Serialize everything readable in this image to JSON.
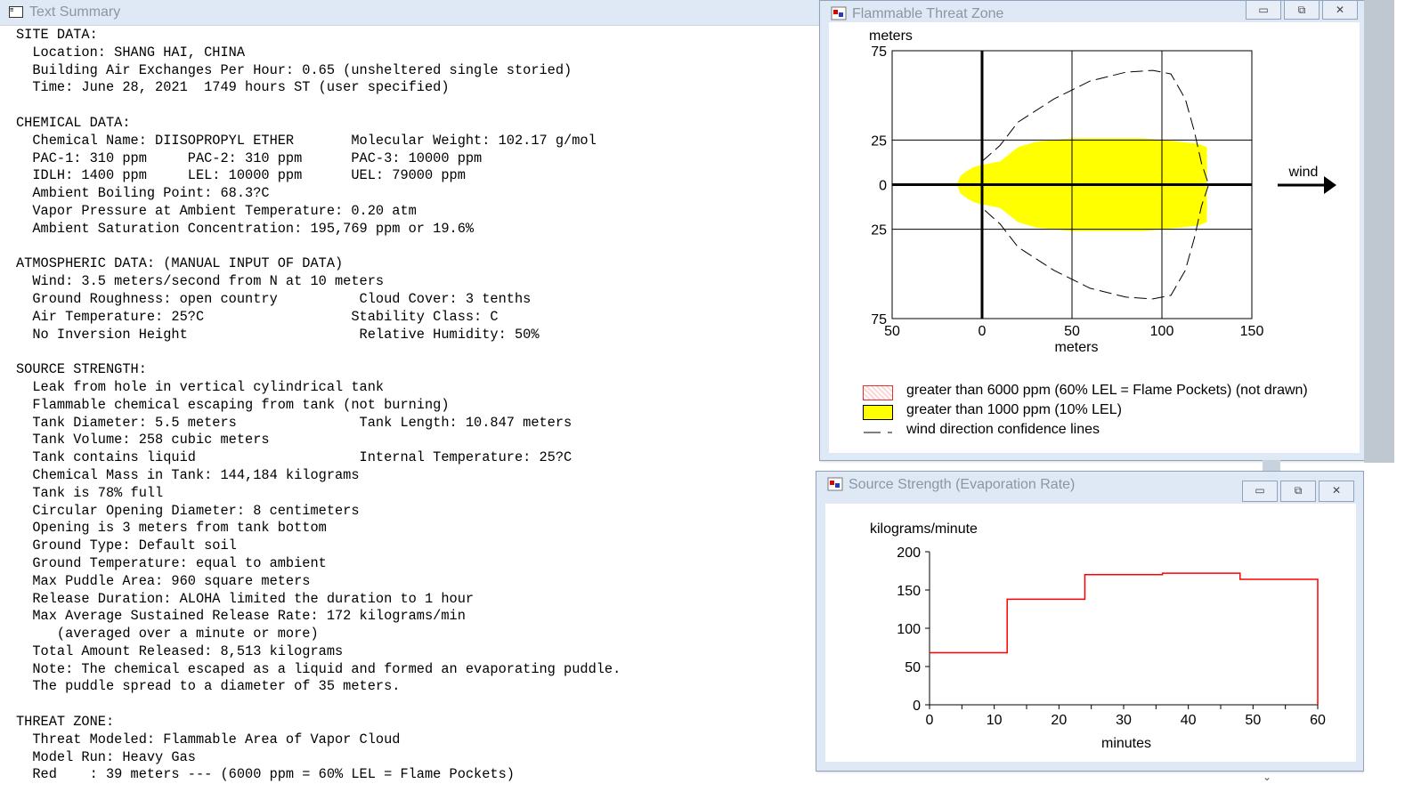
{
  "text_summary": {
    "title": "Text Summary",
    "lines": [
      "SITE DATA:",
      "  Location: SHANG HAI, CHINA",
      "  Building Air Exchanges Per Hour: 0.65 (unsheltered single storied)",
      "  Time: June 28, 2021  1749 hours ST (user specified)",
      "",
      "CHEMICAL DATA:",
      "  Chemical Name: DIISOPROPYL ETHER       Molecular Weight: 102.17 g/mol",
      "  PAC-1: 310 ppm     PAC-2: 310 ppm      PAC-3: 10000 ppm",
      "  IDLH: 1400 ppm     LEL: 10000 ppm      UEL: 79000 ppm",
      "  Ambient Boiling Point: 68.3?C",
      "  Vapor Pressure at Ambient Temperature: 0.20 atm",
      "  Ambient Saturation Concentration: 195,769 ppm or 19.6%",
      "",
      "ATMOSPHERIC DATA: (MANUAL INPUT OF DATA)",
      "  Wind: 3.5 meters/second from N at 10 meters",
      "  Ground Roughness: open country          Cloud Cover: 3 tenths",
      "  Air Temperature: 25?C                  Stability Class: C",
      "  No Inversion Height                     Relative Humidity: 50%",
      "",
      "SOURCE STRENGTH:",
      "  Leak from hole in vertical cylindrical tank",
      "  Flammable chemical escaping from tank (not burning)",
      "  Tank Diameter: 5.5 meters               Tank Length: 10.847 meters",
      "  Tank Volume: 258 cubic meters",
      "  Tank contains liquid                    Internal Temperature: 25?C",
      "  Chemical Mass in Tank: 144,184 kilograms",
      "  Tank is 78% full",
      "  Circular Opening Diameter: 8 centimeters",
      "  Opening is 3 meters from tank bottom",
      "  Ground Type: Default soil",
      "  Ground Temperature: equal to ambient",
      "  Max Puddle Area: 960 square meters",
      "  Release Duration: ALOHA limited the duration to 1 hour",
      "  Max Average Sustained Release Rate: 172 kilograms/min",
      "     (averaged over a minute or more)",
      "  Total Amount Released: 8,513 kilograms",
      "  Note: The chemical escaped as a liquid and formed an evaporating puddle.",
      "  The puddle spread to a diameter of 35 meters.",
      "",
      "THREAT ZONE:",
      "  Threat Modeled: Flammable Area of Vapor Cloud",
      "  Model Run: Heavy Gas",
      "  Red    : 39 meters --- (6000 ppm = 60% LEL = Flame Pockets)"
    ]
  },
  "threat_window": {
    "title": "Flammable Threat Zone",
    "buttons": {
      "minimize": "▭",
      "restore": "⧉",
      "close": "✕"
    },
    "y_unit": "meters",
    "x_unit": "meters",
    "y_ticks": [
      "75",
      "25",
      "0",
      "25",
      "75"
    ],
    "x_ticks": [
      "50",
      "0",
      "50",
      "100",
      "150"
    ],
    "wind_label": "wind",
    "legend": [
      {
        "label": "greater than 6000 ppm (60% LEL = Flame Pockets) (not drawn)",
        "color": "#ffdede"
      },
      {
        "label": "greater than 1000 ppm (10% LEL)",
        "color": "#ffff00"
      },
      {
        "label": "wind direction confidence lines",
        "color": "#000000"
      }
    ],
    "icon": "chart-window-icon"
  },
  "source_window": {
    "title": "Source Strength (Evaporation Rate)",
    "buttons": {
      "minimize": "▭",
      "restore": "⧉",
      "close": "✕"
    },
    "icon": "chart-window-icon"
  },
  "chart_data": [
    {
      "type": "area",
      "title": "Flammable Threat Zone",
      "xlabel": "meters",
      "ylabel": "meters",
      "xlim": [
        -50,
        150
      ],
      "ylim": [
        -75,
        75
      ],
      "x_tick_labels": [
        "50",
        "0",
        "50",
        "100",
        "150"
      ],
      "y_tick_labels": [
        "75",
        "25",
        "0",
        "25",
        "75"
      ],
      "grid": true,
      "series": [
        {
          "name": "greater than 1000 ppm (10% LEL)",
          "color": "#ffff00",
          "x": [
            -14,
            -12,
            -8,
            -4,
            0,
            5,
            10,
            15,
            20,
            30,
            40,
            50,
            60,
            70,
            80,
            90,
            100,
            110,
            120,
            125,
            125,
            120,
            110,
            100,
            90,
            80,
            70,
            60,
            50,
            40,
            30,
            20,
            15,
            10,
            5,
            0,
            -4,
            -8,
            -12,
            -14
          ],
          "y": [
            0,
            5,
            8,
            10,
            11,
            12,
            13,
            17,
            21,
            24,
            25,
            26,
            26,
            26,
            26,
            26,
            25,
            24,
            23,
            21,
            -21,
            -23,
            -24,
            -25,
            -26,
            -26,
            -26,
            -26,
            -26,
            -25,
            -24,
            -21,
            -17,
            -13,
            -12,
            -11,
            -10,
            -8,
            -5,
            0
          ]
        },
        {
          "name": "wind direction confidence lines",
          "color": "#000000",
          "x": [
            0,
            10,
            20,
            40,
            60,
            80,
            95,
            105,
            113,
            118,
            122,
            126,
            126,
            122,
            118,
            113,
            105,
            95,
            80,
            60,
            40,
            20,
            10,
            0
          ],
          "y": [
            13,
            22,
            35,
            48,
            58,
            63,
            64,
            62,
            48,
            30,
            12,
            0,
            0,
            -12,
            -30,
            -48,
            -62,
            -64,
            -63,
            -58,
            -48,
            -35,
            -22,
            -13
          ]
        }
      ],
      "annotation": "wind"
    },
    {
      "type": "line",
      "title": "Source Strength (Evaporation Rate)",
      "xlabel": "minutes",
      "ylabel": "kilograms/minute",
      "xlim": [
        0,
        60
      ],
      "ylim": [
        0,
        200
      ],
      "x_ticks": [
        0,
        10,
        20,
        30,
        40,
        50,
        60
      ],
      "y_ticks": [
        0,
        50,
        100,
        150,
        200
      ],
      "series": [
        {
          "color": "#ff0000",
          "step": true,
          "x": [
            0,
            12,
            12,
            24,
            24,
            36,
            36,
            48,
            48,
            60,
            60
          ],
          "y": [
            68,
            68,
            138,
            138,
            170,
            170,
            172,
            172,
            164,
            164,
            0
          ]
        }
      ]
    }
  ]
}
